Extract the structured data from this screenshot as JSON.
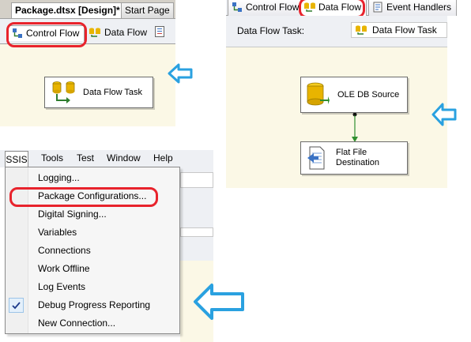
{
  "control_flow_panel": {
    "doc_tab_active": "Package.dtsx [Design]*",
    "doc_tab_other": "Start Page",
    "tab_control_flow": "Control Flow",
    "tab_data_flow": "Data Flow",
    "task_label": "Data Flow Task"
  },
  "data_flow_panel": {
    "tab_control_flow": "Control Flow",
    "tab_data_flow": "Data Flow",
    "tab_event_handlers": "Event Handlers",
    "task_selector_label": "Data Flow Task:",
    "task_selector_value": "Data Flow Task",
    "source_label": "OLE DB Source",
    "destination_label": "Flat File Destination"
  },
  "ssis_menu_panel": {
    "menubar": [
      "SSIS",
      "Tools",
      "Test",
      "Window",
      "Help"
    ],
    "items": [
      {
        "label": "Logging..."
      },
      {
        "label": "Package Configurations..."
      },
      {
        "label": "Digital Signing..."
      },
      {
        "label": "Variables"
      },
      {
        "label": "Connections"
      },
      {
        "label": "Work Offline"
      },
      {
        "label": "Log Events"
      },
      {
        "label": "Debug Progress Reporting",
        "checked": true
      },
      {
        "label": "New Connection..."
      }
    ]
  },
  "colors": {
    "highlight_ring": "#e8232c",
    "callout_arrow": "#2aa1e0",
    "designer_background": "#fbf8e6"
  },
  "icons": [
    "data-flow-task-icon",
    "control-flow-tab-icon",
    "ole-db-source-icon",
    "flat-file-destination-icon",
    "check-icon",
    "arrow-left-icon"
  ]
}
